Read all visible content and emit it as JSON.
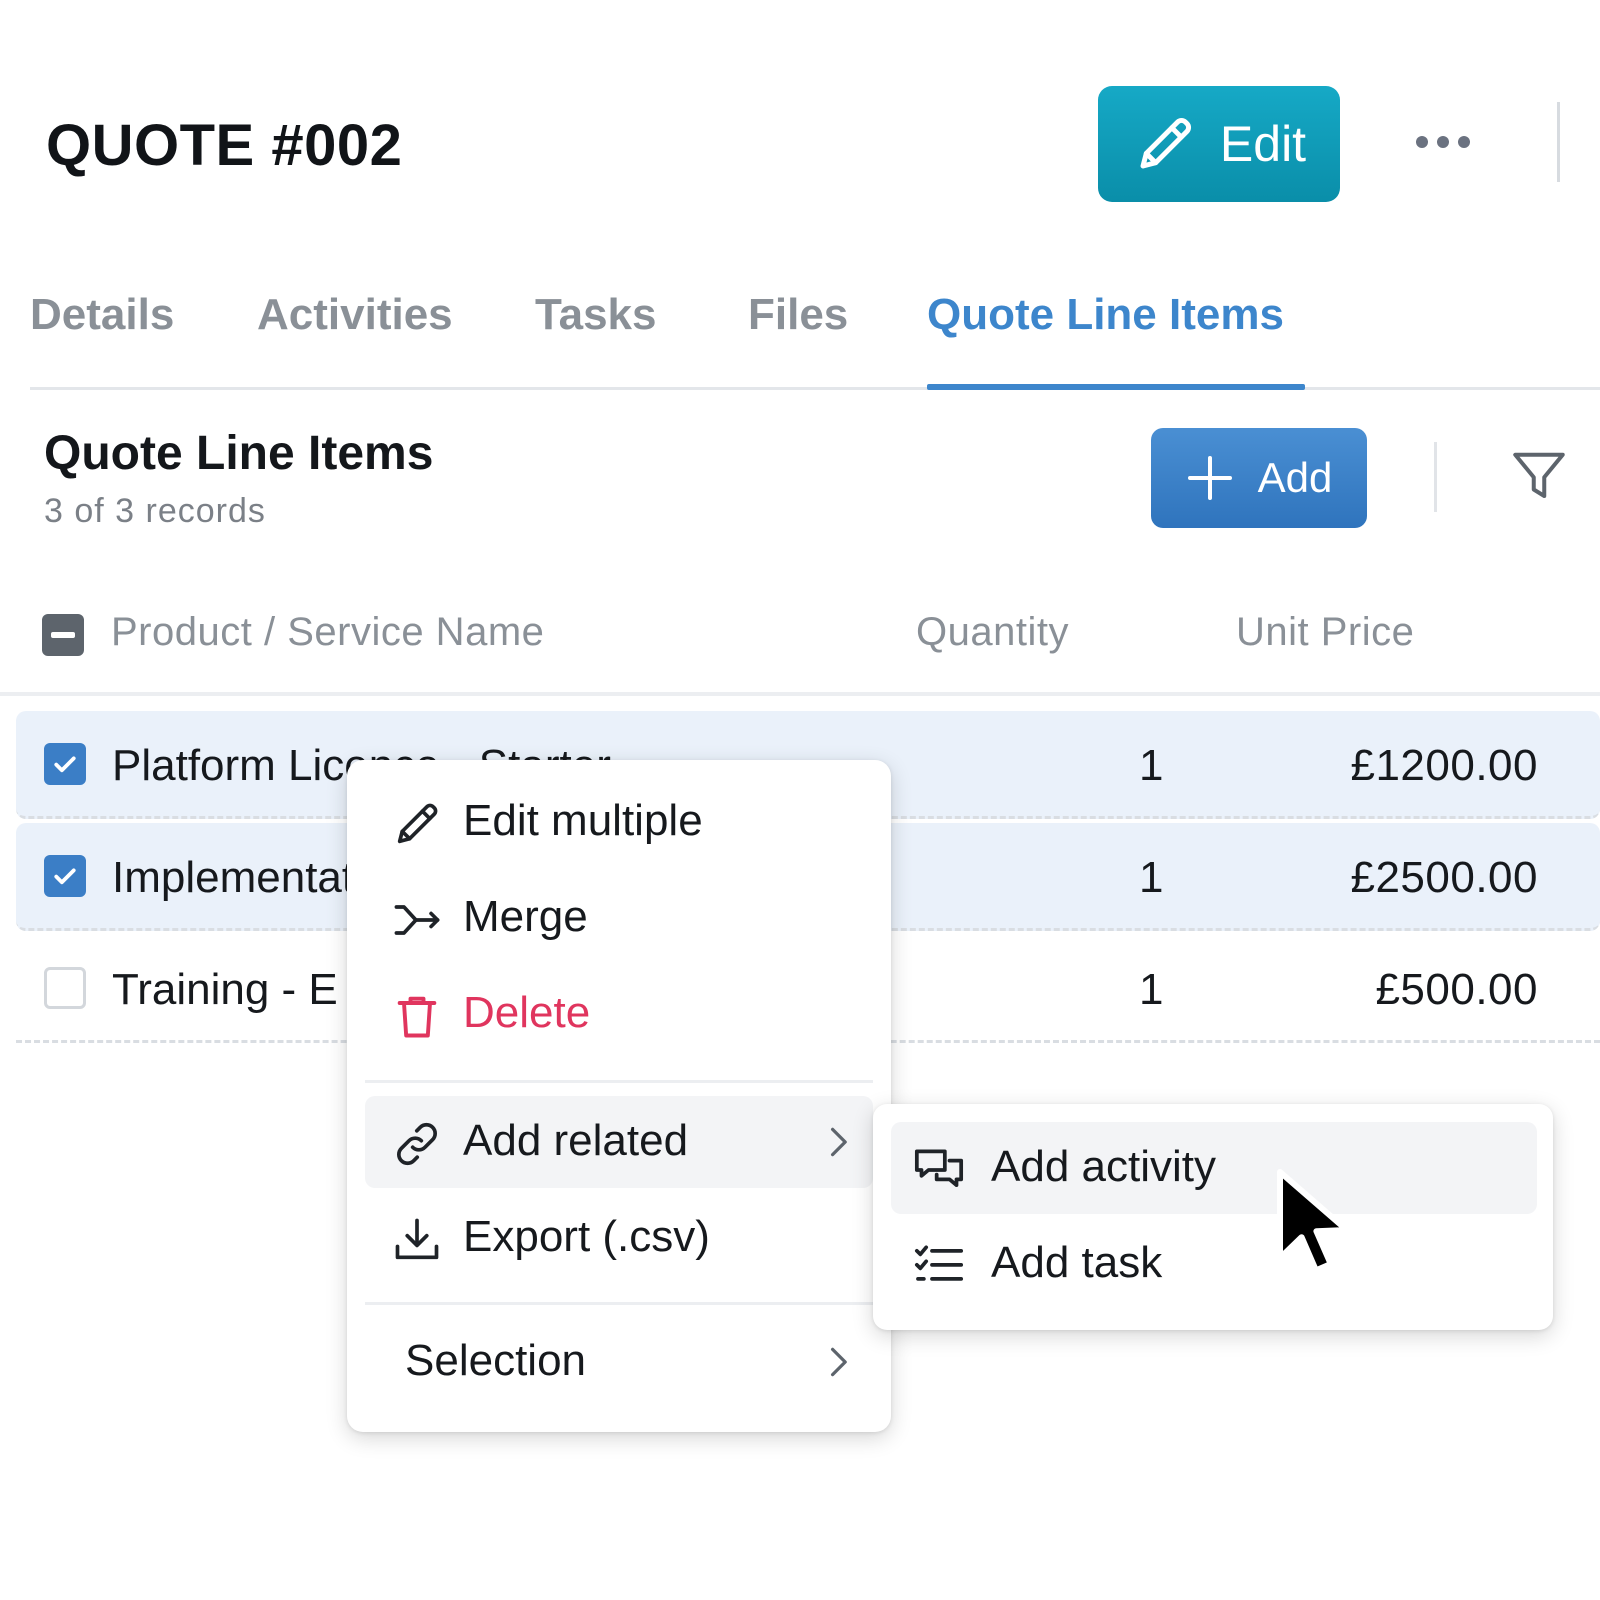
{
  "header": {
    "title": "QUOTE #002",
    "edit_label": "Edit"
  },
  "tabs": [
    {
      "label": "Details"
    },
    {
      "label": "Activities"
    },
    {
      "label": "Tasks"
    },
    {
      "label": "Files"
    },
    {
      "label": "Quote Line Items",
      "active": true
    }
  ],
  "section": {
    "title": "Quote Line Items",
    "subtitle": "3 of 3 records",
    "add_label": "Add"
  },
  "table": {
    "columns": [
      "Product / Service Name",
      "Quantity",
      "Unit Price"
    ],
    "rows": [
      {
        "name": "Platform Licence - Starter",
        "quantity": "1",
        "unit_price": "£1200.00",
        "selected": true
      },
      {
        "name": "Implementation",
        "quantity": "1",
        "unit_price": "£2500.00",
        "selected": true
      },
      {
        "name": "Training - E",
        "quantity": "1",
        "unit_price": "£500.00",
        "selected": false
      }
    ]
  },
  "context_menu": {
    "items": [
      {
        "label": "Edit multiple",
        "icon": "pencil-icon"
      },
      {
        "label": "Merge",
        "icon": "merge-icon"
      },
      {
        "label": "Delete",
        "icon": "trash-icon",
        "color": "#e0355e"
      },
      {
        "label": "Add related",
        "icon": "link-icon",
        "submenu": true
      },
      {
        "label": "Export (.csv)",
        "icon": "download-icon"
      },
      {
        "label": "Selection",
        "submenu": true
      }
    ],
    "submenu": [
      {
        "label": "Add activity",
        "icon": "chat-icon"
      },
      {
        "label": "Add task",
        "icon": "checklist-icon"
      }
    ]
  },
  "colors": {
    "accent": "#3d86cc",
    "edit_button": "#0a9bb8",
    "add_button": "#3b80c8",
    "danger": "#e0355e",
    "row_selected": "#eaf1fa"
  }
}
